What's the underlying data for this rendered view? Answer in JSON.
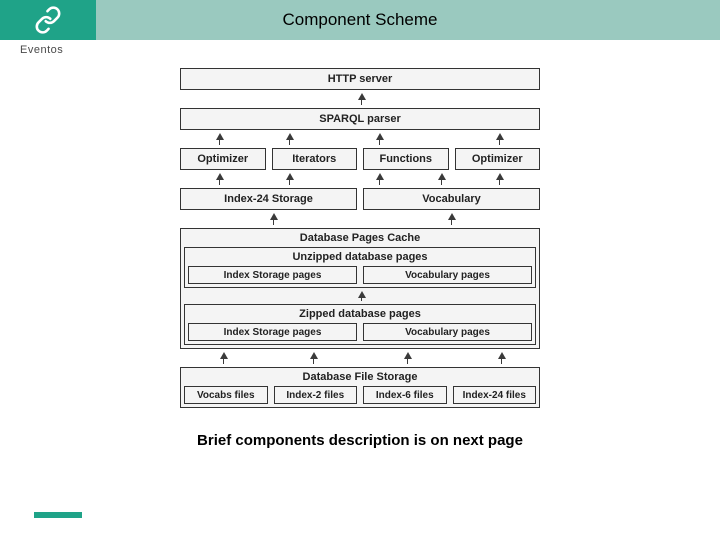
{
  "header": {
    "brand": "Eventos",
    "title": "Component Scheme"
  },
  "diagram": {
    "tier1": "HTTP server",
    "tier2": "SPARQL parser",
    "tier3": {
      "a": "Optimizer",
      "b": "Iterators",
      "c": "Functions",
      "d": "Optimizer"
    },
    "tier4": {
      "a": "Index-24 Storage",
      "b": "Vocabulary"
    },
    "tier5": {
      "title": "Database Pages Cache",
      "unzipped": {
        "title": "Unzipped database pages",
        "a": "Index Storage pages",
        "b": "Vocabulary pages"
      },
      "zipped": {
        "title": "Zipped database pages",
        "a": "Index Storage pages",
        "b": "Vocabulary pages"
      }
    },
    "tier6": {
      "title": "Database File Storage",
      "a": "Vocabs files",
      "b": "Index-2 files",
      "c": "Index-6 files",
      "d": "Index-24 files"
    }
  },
  "footer": "Brief components description is on next page"
}
